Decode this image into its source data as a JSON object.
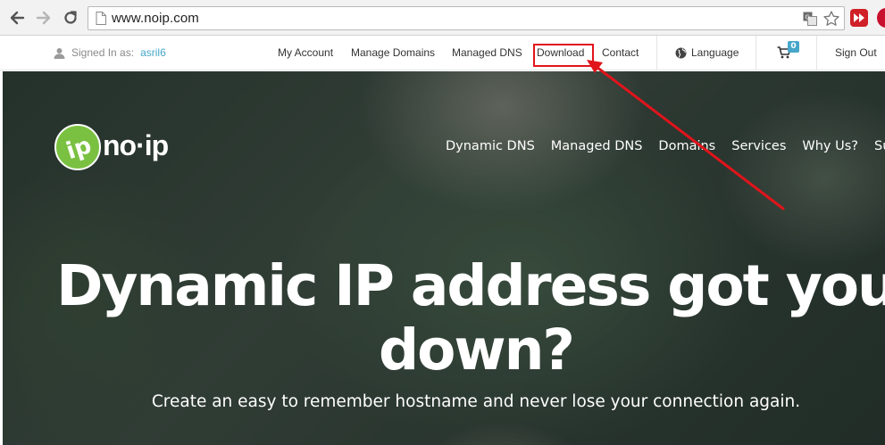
{
  "browser": {
    "url": "www.noip.com"
  },
  "topbar": {
    "signed_in_label": "Signed In as:",
    "username": "asril6",
    "links": [
      "My Account",
      "Manage Domains",
      "Managed DNS",
      "Download",
      "Contact"
    ],
    "language": "Language",
    "cart_count": "0",
    "sign_out": "Sign Out"
  },
  "logo": {
    "text": "no·ip",
    "mark": "ip"
  },
  "main_nav": [
    "Dynamic DNS",
    "Managed DNS",
    "Domains",
    "Services",
    "Why Us?",
    "Support"
  ],
  "hero": {
    "headline_line1": "Dynamic IP address got you",
    "headline_line2": "down?",
    "subheadline": "Create an easy to remember hostname and never lose your connection again."
  },
  "colors": {
    "accent_blue": "#46a7c9",
    "logo_green": "#7ac142",
    "annotation_red": "#e1141b"
  },
  "icons": [
    "back-arrow-icon",
    "forward-arrow-icon",
    "reload-icon",
    "page-icon",
    "translate-icon",
    "star-icon",
    "user-icon",
    "globe-icon",
    "cart-icon"
  ]
}
